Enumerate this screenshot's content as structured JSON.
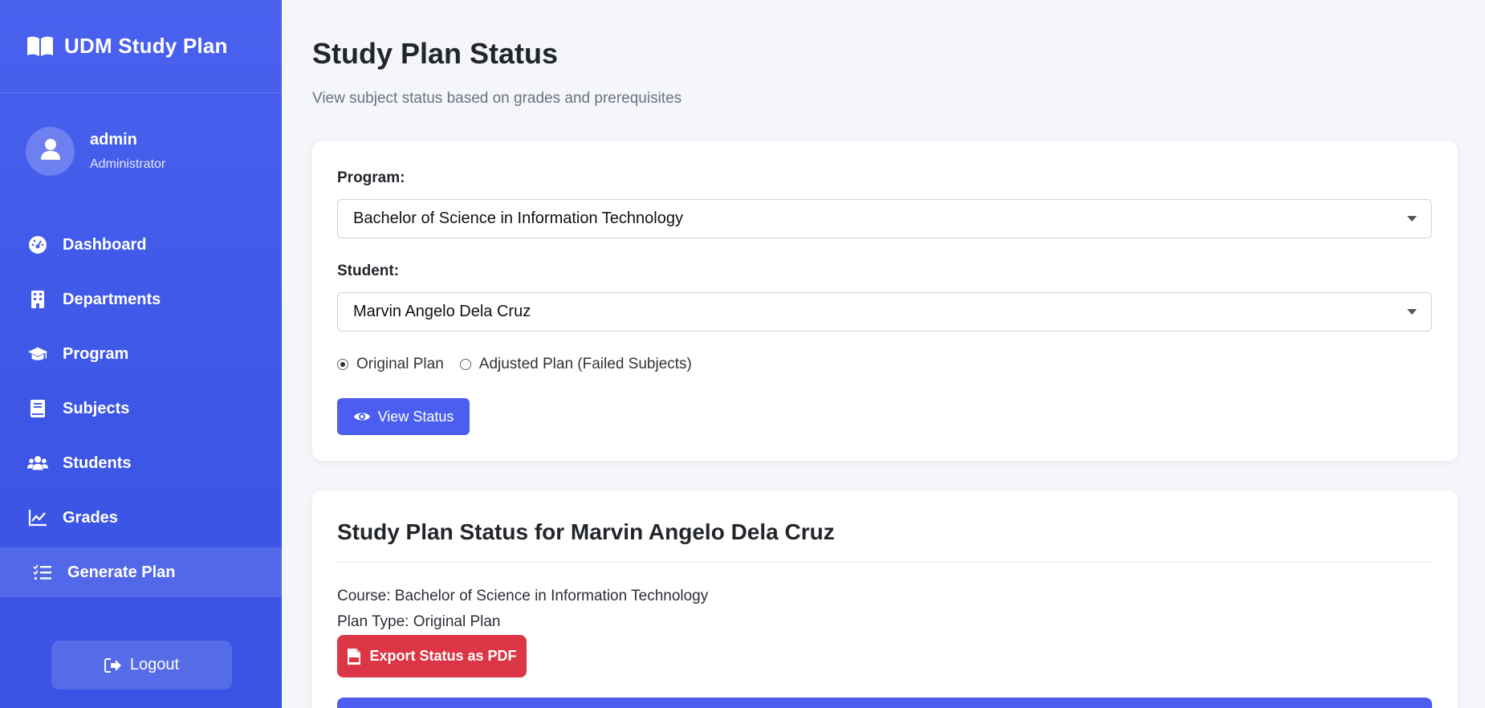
{
  "brand": {
    "title": "UDM Study Plan",
    "icon": "book-open-icon"
  },
  "user": {
    "name": "admin",
    "role": "Administrator"
  },
  "nav": [
    {
      "label": "Dashboard",
      "icon": "gauge-icon"
    },
    {
      "label": "Departments",
      "icon": "building-icon"
    },
    {
      "label": "Program",
      "icon": "graduation-cap-icon"
    },
    {
      "label": "Subjects",
      "icon": "book-icon"
    },
    {
      "label": "Students",
      "icon": "users-icon"
    },
    {
      "label": "Grades",
      "icon": "chart-line-icon"
    },
    {
      "label": "Generate Plan",
      "icon": "list-check-icon",
      "active": true
    }
  ],
  "logout_label": "Logout",
  "header": {
    "title": "Study Plan Status",
    "subtitle": "View subject status based on grades and prerequisites"
  },
  "filter": {
    "program_label": "Program:",
    "program_value": "Bachelor of Science in Information Technology",
    "student_label": "Student:",
    "student_value": "Marvin Angelo Dela Cruz",
    "radio_original": "Original Plan",
    "radio_adjusted": "Adjusted Plan (Failed Subjects)",
    "selected_plan": "Original Plan",
    "view_button": "View Status"
  },
  "status": {
    "title": "Study Plan Status for Marvin Angelo Dela Cruz",
    "course_line": "Course: Bachelor of Science in Information Technology",
    "plan_type_line": "Plan Type: Original Plan",
    "export_button": "Export Status as PDF"
  },
  "colors": {
    "sidebar": "#4a61ee",
    "primary_button": "#4b5ef0",
    "danger_button": "#dc3545",
    "page_background": "#f5f6fa"
  }
}
